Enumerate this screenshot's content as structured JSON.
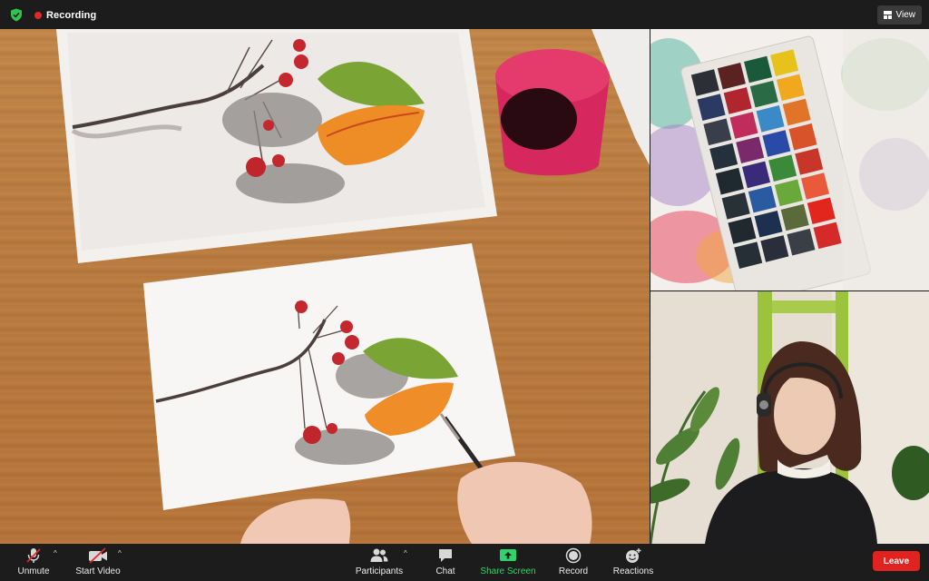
{
  "topbar": {
    "recording_label": "Recording",
    "view_label": "View",
    "colors": {
      "shield": "#2ec44d",
      "record_dot": "#e02828"
    }
  },
  "toolbar": {
    "unmute_label": "Unmute",
    "start_video_label": "Start Video",
    "participants_label": "Participants",
    "chat_label": "Chat",
    "share_screen_label": "Share Screen",
    "record_label": "Record",
    "reactions_label": "Reactions",
    "leave_label": "Leave",
    "caret_glyph": "^",
    "colors": {
      "share_screen": "#2fd36b",
      "leave": "#e0231f",
      "muted_slash": "#e02828"
    }
  },
  "icons": [
    "security-shield-icon",
    "recording-dot-icon",
    "view-grid-icon",
    "microphone-muted-icon",
    "video-off-icon",
    "participants-icon",
    "chat-icon",
    "share-screen-icon",
    "record-icon",
    "reactions-icon",
    "chevron-up-icon"
  ]
}
